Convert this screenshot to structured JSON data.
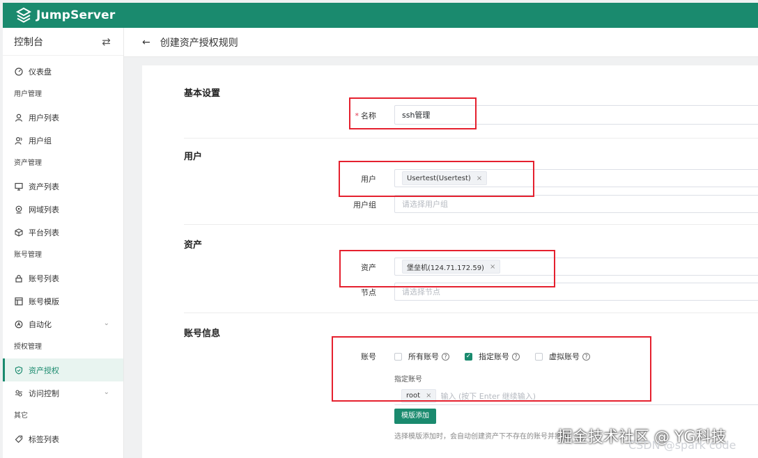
{
  "app": {
    "brand": "JumpServer",
    "accent": "#1a8a6e"
  },
  "sidebar": {
    "title": "控制台",
    "items": [
      {
        "type": "item",
        "label": "仪表盘",
        "icon": "dashboard-icon"
      },
      {
        "type": "group",
        "label": "用户管理"
      },
      {
        "type": "item",
        "label": "用户列表",
        "icon": "user-icon"
      },
      {
        "type": "item",
        "label": "用户组",
        "icon": "user-group-icon"
      },
      {
        "type": "group",
        "label": "资产管理"
      },
      {
        "type": "item",
        "label": "资产列表",
        "icon": "monitor-icon"
      },
      {
        "type": "item",
        "label": "网域列表",
        "icon": "location-icon"
      },
      {
        "type": "item",
        "label": "平台列表",
        "icon": "cube-icon"
      },
      {
        "type": "group",
        "label": "账号管理"
      },
      {
        "type": "item",
        "label": "账号列表",
        "icon": "lock-icon"
      },
      {
        "type": "item",
        "label": "账号模版",
        "icon": "template-icon"
      },
      {
        "type": "item",
        "label": "自动化",
        "icon": "automation-icon",
        "expandable": true
      },
      {
        "type": "group",
        "label": "授权管理"
      },
      {
        "type": "item",
        "label": "资产授权",
        "icon": "shield-icon",
        "active": true
      },
      {
        "type": "item",
        "label": "访问控制",
        "icon": "access-icon",
        "expandable": true
      },
      {
        "type": "group",
        "label": "其它"
      },
      {
        "type": "item",
        "label": "标签列表",
        "icon": "tag-icon"
      }
    ]
  },
  "breadcrumb": {
    "title": "创建资产授权规则"
  },
  "form": {
    "basic": {
      "section": "基本设置",
      "name_label": "名称",
      "name_value": "ssh管理"
    },
    "user": {
      "section": "用户",
      "users_label": "用户",
      "users_tags": [
        "Usertest(Usertest)"
      ],
      "groups_label": "用户组",
      "groups_placeholder": "请选择用户组"
    },
    "asset": {
      "section": "资产",
      "assets_label": "资产",
      "assets_tags": [
        "堡垒机(124.71.172.59)"
      ],
      "nodes_label": "节点",
      "nodes_placeholder": "请选择节点"
    },
    "account": {
      "section": "账号信息",
      "account_label": "账号",
      "options": [
        {
          "label": "所有账号",
          "checked": false
        },
        {
          "label": "指定账号",
          "checked": true
        },
        {
          "label": "虚拟账号",
          "checked": false
        }
      ],
      "specified_label": "指定账号",
      "specified_tags": [
        "root"
      ],
      "specified_placeholder": "输入 (按下 Enter 继续输入)",
      "template_button": "模版添加",
      "hint": "选择模版添加时，会自动创建资产下不存在的账号并推送"
    }
  },
  "watermarks": {
    "main": "掘金技术社区 @ YG科技",
    "secondary": "CSDN @spark code"
  }
}
